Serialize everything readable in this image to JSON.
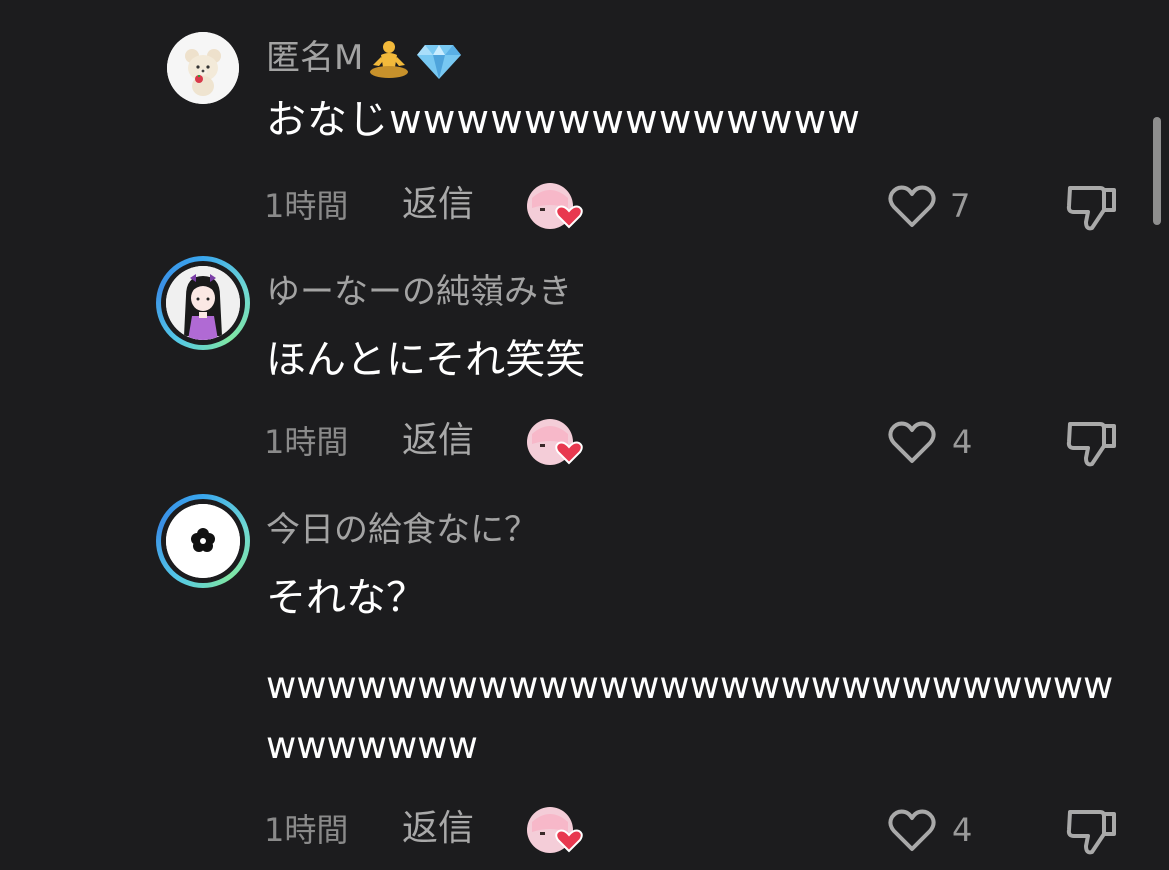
{
  "comments": [
    {
      "username": "匿名M",
      "text": "おなじwwwwwwwwwwwwww",
      "time": "1時間",
      "reply": "返信",
      "likes": "7"
    },
    {
      "username": "ゆーなーの純嶺みき",
      "text": "ほんとにそれ笑笑",
      "time": "1時間",
      "reply": "返信",
      "likes": "4"
    },
    {
      "username": "今日の給食なに？",
      "text": "それな？",
      "text_line2": "wwwwwwwwwwwwwwwwwwwwwwwwwwww",
      "text_line3": "wwwwwww",
      "time": "1時間",
      "reply": "返信",
      "likes": "4"
    }
  ],
  "colors": {
    "background": "#1c1c1e",
    "heart_badge": "#e8384f",
    "ring": "#5cc9e6"
  },
  "icons": [
    "avatar-bear-icon",
    "avatar-girl-icon",
    "avatar-flower-icon",
    "meditation-emoji-icon",
    "diamond-emoji-icon",
    "creator-like-icon",
    "heart-outline-icon",
    "thumbs-down-icon"
  ]
}
